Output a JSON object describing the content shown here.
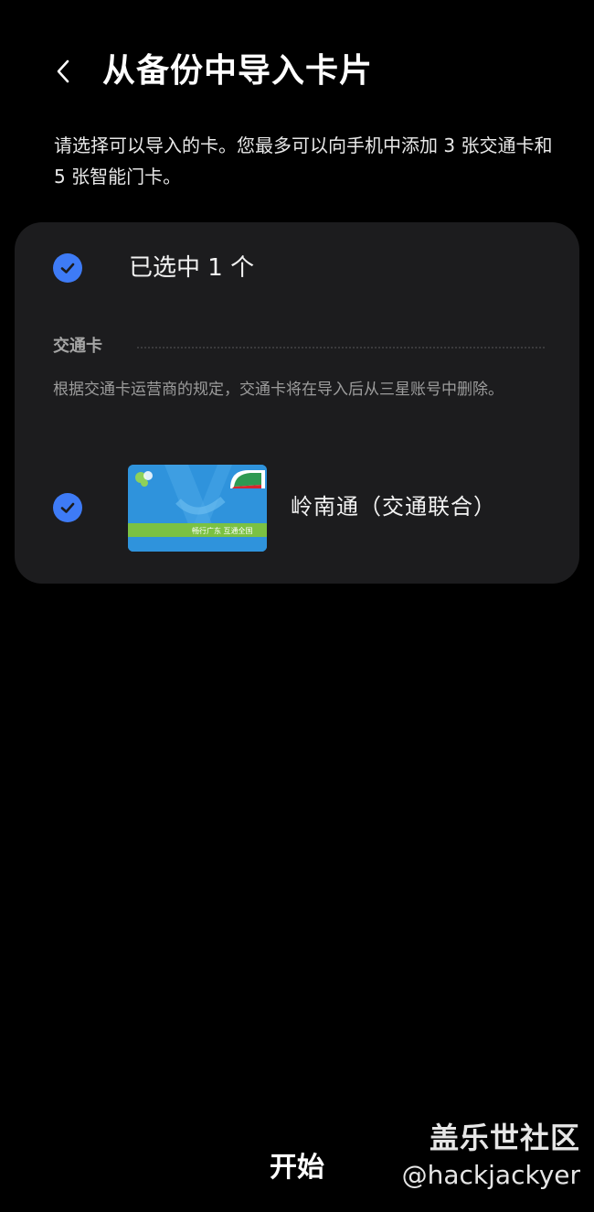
{
  "header": {
    "title": "从备份中导入卡片",
    "back_icon": "chevron-left-icon"
  },
  "description": "请选择可以导入的卡。您最多可以向手机中添加 3 张交通卡和 5 张智能门卡。",
  "panel": {
    "select_all": {
      "label": "已选中 1 个",
      "checked": true
    },
    "section": {
      "title": "交通卡",
      "notice": "根据交通卡运营商的规定，交通卡将在导入后从三星账号中删除。"
    },
    "cards": [
      {
        "name": "岭南通（交通联合）",
        "checked": true,
        "thumb_text": "畅行广东 互通全国"
      }
    ]
  },
  "footer": {
    "start_label": "开始"
  },
  "watermark": {
    "title": "盖乐世社区",
    "handle": "@hackjackyer"
  },
  "colors": {
    "background": "#000000",
    "panel": "#1c1c1e",
    "accent": "#3e7bf6"
  }
}
